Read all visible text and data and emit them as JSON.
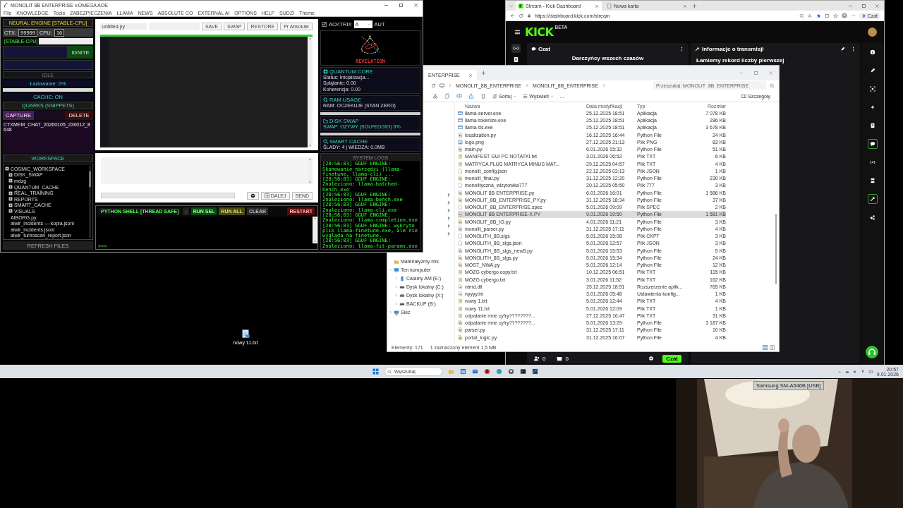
{
  "app_window": {
    "title": "MONOLIT 8B ENTERPRISE v.OMEGA AOE",
    "menu": [
      "File",
      "KNOWLEDGE",
      "Tools",
      "ZABEZPIECZENIA",
      "LLAMA",
      "NEWS",
      "ABSOLUTE CO",
      "EXTERNAL AI",
      "OPTIONS",
      "HELP",
      "SUDZI",
      "Theme"
    ],
    "engine": {
      "header": "NEURAL ENGINE [STABLE-CPU]",
      "ctx_label": "CTX:",
      "ctx_value": "99999",
      "cpu_label": "CPU:",
      "cpu_value": "16",
      "mode_tag": "[STABLE-CPU]",
      "ignite": "IGNITE",
      "status": "IDLE",
      "loading": "Ładowanie: 0%",
      "level": 0,
      "cache": "CACHE: ON"
    },
    "quarks": {
      "header": "QUARKS (SNIPPETS)",
      "capture": "CAPTURE",
      "delete": "DELETE",
      "items": [
        "CTXMEM_CHAT_20260105_230012_8648"
      ]
    },
    "workspace": {
      "header": "WORKSPACE",
      "tree": [
        {
          "label": "COSMIC_WORKSPACE",
          "kind": "folder",
          "children": [
            {
              "label": "DISK_SWAP",
              "kind": "folder"
            },
            {
              "label": "mdzg",
              "kind": "folder"
            },
            {
              "label": "QUANTUM_CACHE",
              "kind": "folder"
            },
            {
              "label": "REAL_TRAINING",
              "kind": "folder"
            },
            {
              "label": "REPORTS",
              "kind": "folder"
            },
            {
              "label": "SMART_CACHE",
              "kind": "folder"
            },
            {
              "label": "VISUALS",
              "kind": "folder"
            },
            {
              "label": "AIBORG.py",
              "kind": "file"
            },
            {
              "label": "aiwir_incidents — kopia.jsonl",
              "kind": "file"
            },
            {
              "label": "aiwir_incidents.jsonl",
              "kind": "file"
            },
            {
              "label": "aiwir_turboscan_report.json",
              "kind": "file"
            }
          ]
        }
      ],
      "refresh": "REFRESH FILES"
    },
    "editor": {
      "filename": "untitled.py",
      "buttons": [
        "SAVE",
        "SWAP",
        "RESTORE",
        "Pr Absolute"
      ],
      "level": 1,
      "next": "DALEJ",
      "send": "SEND"
    },
    "shell": {
      "title": "PYTHON SHELL [THREAD SAFE]",
      "buttons": [
        {
          "label": "-",
          "kind": "plain"
        },
        {
          "label": "RUN SEL",
          "kind": "run"
        },
        {
          "label": "RUN ALL",
          "kind": "all"
        },
        {
          "label": "CLEAR",
          "kind": "clear"
        }
      ],
      "restart": "RESTART",
      "prompt": ">>>"
    },
    "side": {
      "toggle": {
        "label": "ACKTRIX",
        "checked": true
      },
      "select": "A",
      "auto": "AUT",
      "visual_label": "REVELATION",
      "cards": [
        {
          "title": "QUANTUM CORE",
          "kind": "core",
          "lines": [
            "Status: Inicjalizacja...",
            "Splątanie: 0.00",
            "Koherencja: 0.00"
          ]
        },
        {
          "title": "RAM USAGE",
          "kind": "ram",
          "lines": [
            "RAM: OCZEKUJE (STAN ZERO)"
          ],
          "level": 0
        },
        {
          "title": "DISK SWAP",
          "kind": "disk",
          "lines": [
            "SWAP: OŻYWY (SOLFEGGIO) 0%"
          ],
          "level": 0
        },
        {
          "title": "SMART CACHE",
          "kind": "cache",
          "lines": [
            "ŚLADY: 4 | WIEDZA: 0.0MB"
          ]
        }
      ],
      "logs": {
        "title": "SYSTEM LOGS",
        "lines": [
          "[20:56:03] GGUF ENGINE: Skanowanie narzędzi (llama-finetune, llama-cli) ...",
          "[20:56:03] GGUF ENGINE: Znaleziono: llama-batched-bench.exe",
          "[20:56:03] GGUF ENGINE: Znaleziono: llama-bench.exe",
          "[20:56:03] GGUF ENGINE: Znaleziono: llama-cli.exe",
          "[20:56:03] GGUF ENGINE: Znaleziono: llama-completion.exe",
          "[20:56:03] GGUF ENGINE: wykryto plik llama-finetune.exe, ale nie wygląda na finetune.",
          "[20:56:03] GGUF ENGINE: Znaleziono: llama-fit-params.exe"
        ]
      }
    }
  },
  "browser": {
    "tabs": [
      {
        "label": "Stream - Kick Dashboard",
        "selected": true
      },
      {
        "label": "Nowa karta",
        "selected": false
      }
    ],
    "url": "https://dashboard.kick.com/stream",
    "copilot": "Czat",
    "logo": "KICK",
    "logo_badge": "BETA",
    "nav": [
      {
        "kind": "broadcast",
        "selected": true
      },
      {
        "kind": "doc",
        "selected": false
      }
    ],
    "panels": [
      {
        "title": "Czat",
        "kind": "chat",
        "body": "Darczyńcy wszech czasów"
      },
      {
        "title": "Informacje o transmisji",
        "kind": "info",
        "body": "Łamiemy rekord liczby pierwszej"
      }
    ],
    "footer": {
      "viewers": "0",
      "gifts": "0",
      "chat_button": "Czat"
    },
    "rail": [
      {
        "kind": "info",
        "selected": false
      },
      {
        "kind": "pencil",
        "selected": false
      },
      {
        "kind": "scan",
        "selected": false
      },
      {
        "kind": "bolt",
        "selected": false
      },
      {
        "kind": "doc",
        "selected": false
      },
      {
        "kind": "chat",
        "selected": true
      },
      {
        "kind": "broadcast",
        "selected": false
      },
      {
        "kind": "stack",
        "selected": false
      },
      {
        "kind": "wrench",
        "selected": true
      },
      {
        "kind": "share",
        "selected": false
      }
    ]
  },
  "explorer": {
    "tab": "ENTERPRISE",
    "breadcrumb": [
      "MONOLIT_8B_ENTERPRISE",
      "MONOLIT_8B_ENTERPRISE"
    ],
    "search_placeholder": "Przeszukaj: MONOLIT_8B_ENTERPRISE",
    "toolbar": [
      "Sortuj",
      "Wyświetl",
      "..."
    ],
    "details": "Szczegóły",
    "nav": [
      {
        "label": "Materiałyzmy mis",
        "kind": "folder"
      },
      {
        "label": "Ten komputer",
        "kind": "computer",
        "expanded": true,
        "children": [
          {
            "label": "Calamy AM (E:)",
            "kind": "drive",
            "expanded": false
          },
          {
            "label": "Dysk lokalny (C:)",
            "kind": "disk",
            "expanded": false
          },
          {
            "label": "Dysk lokalny (X:)",
            "kind": "disk",
            "expanded": false
          },
          {
            "label": "BACKUP (B:)",
            "kind": "disk",
            "expanded": false
          }
        ]
      },
      {
        "label": "Sieć",
        "kind": "network",
        "expanded": false
      }
    ],
    "columns": [
      "Nazwa",
      "Data modyfikacji",
      "Typ",
      "Rozmiar"
    ],
    "files": [
      {
        "name": "llama-server.exe",
        "modified": "25.12.2025 18:51",
        "type": "Aplikacja",
        "size": "7 078 KB",
        "kind": "exe",
        "selected": false
      },
      {
        "name": "llama-tokenize.exe",
        "modified": "25.12.2025 18:51",
        "type": "Aplikacja",
        "size": "286 KB",
        "kind": "exe",
        "selected": false
      },
      {
        "name": "llama-tts.exe",
        "modified": "25.12.2025 18:51",
        "type": "Aplikacja",
        "size": "3 678 KB",
        "kind": "exe",
        "selected": false
      },
      {
        "name": "localization.py",
        "modified": "16.12.2025 16:44",
        "type": "Python File",
        "size": "24 KB",
        "kind": "py",
        "selected": false
      },
      {
        "name": "logo.png",
        "modified": "27.12.2025 21:13",
        "type": "Plik PNG",
        "size": "83 KB",
        "kind": "png",
        "selected": false
      },
      {
        "name": "main.py",
        "modified": "6.01.2026 15:32",
        "type": "Python File",
        "size": "51 KB",
        "kind": "py",
        "selected": false
      },
      {
        "name": "MANIFEST GUI PC NOTATKI.txt",
        "modified": "3.01.2026 06:52",
        "type": "Plik TXT",
        "size": "6 KB",
        "kind": "txt",
        "selected": false
      },
      {
        "name": "MATRYCA PLUS MATRYCA MINUS MAT...",
        "modified": "29.12.2025 04:57",
        "type": "Plik TXT",
        "size": "4 KB",
        "kind": "txt",
        "selected": false
      },
      {
        "name": "monolit_config.json",
        "modified": "22.12.2025 03:13",
        "type": "Plik JSON",
        "size": "1 KB",
        "kind": "plain",
        "selected": false
      },
      {
        "name": "monolit_final.py",
        "modified": "31.12.2025 12:20",
        "type": "Python File",
        "size": "230 KB",
        "kind": "py",
        "selected": false
      },
      {
        "name": "monolityczna_wizytowka777",
        "modified": "20.12.2025 05:50",
        "type": "Plik 777",
        "size": "3 KB",
        "kind": "plain",
        "selected": false
      },
      {
        "name": "MONOLIT 8B ENTERPRISE.py",
        "modified": "6.01.2026 16:01",
        "type": "Python File",
        "size": "1 586 KB",
        "kind": "py",
        "selected": false
      },
      {
        "name": "MONOLIT_8B_ENTERPRISE_PY.py",
        "modified": "31.12.2025 18:34",
        "type": "Python File",
        "size": "37 KB",
        "kind": "py",
        "selected": false
      },
      {
        "name": "MONOLIT_8B_ENTERPRISE.spec",
        "modified": "5.01.2026 09:09",
        "type": "Plik SPEC",
        "size": "2 KB",
        "kind": "plain",
        "selected": false
      },
      {
        "name": "MONOLIT 8B ENTERPRISE-X.PY",
        "modified": "9.01.2026 19:50",
        "type": "Python File",
        "size": "1 581 KB",
        "kind": "py",
        "selected": true
      },
      {
        "name": "MONOLIT_8B_IO.py",
        "modified": "4.01.2026 11:21",
        "type": "Python File",
        "size": "3 KB",
        "kind": "py",
        "selected": false
      },
      {
        "name": "monolit_parser.py",
        "modified": "31.12.2025 17:11",
        "type": "Python File",
        "size": "4 KB",
        "kind": "py",
        "selected": false
      },
      {
        "name": "MONOLITH_8B.slgs",
        "modified": "5.01.2026 15:08",
        "type": "Plik CKPT",
        "size": "3 KB",
        "kind": "plain",
        "selected": false
      },
      {
        "name": "MONOLITH_8B_slgs.json",
        "modified": "5.01.2026 12:57",
        "type": "Plik JSON",
        "size": "3 KB",
        "kind": "plain",
        "selected": false
      },
      {
        "name": "MONOLITH_8B_slgs_new5.py",
        "modified": "5.01.2026 15:53",
        "type": "Python File",
        "size": "5 KB",
        "kind": "py",
        "selected": false
      },
      {
        "name": "MONOLITH_8B_slgs.py",
        "modified": "5.01.2026 15:34",
        "type": "Python File",
        "size": "24 KB",
        "kind": "py",
        "selected": false
      },
      {
        "name": "MOST_NWA.py",
        "modified": "5.01.2026 12:14",
        "type": "Python File",
        "size": "12 KB",
        "kind": "py",
        "selected": false
      },
      {
        "name": "MÓZG cybergo copy.txt",
        "modified": "10.12.2025 06:51",
        "type": "Plik TXT",
        "size": "115 KB",
        "kind": "txt",
        "selected": false
      },
      {
        "name": "MÓZG cybergo.txt",
        "modified": "3.01.2026 11:52",
        "type": "Plik TXT",
        "size": "162 KB",
        "kind": "txt",
        "selected": false
      },
      {
        "name": "ntmd.dll",
        "modified": "25.12.2025 18:51",
        "type": "Rozszerzenie aplik...",
        "size": "765 KB",
        "kind": "gear",
        "selected": false
      },
      {
        "name": "nyyyy.ini",
        "modified": "3.01.2026 05:48",
        "type": "Ustawienia konfig...",
        "size": "1 KB",
        "kind": "gear",
        "selected": false
      },
      {
        "name": "nowy 1.txt",
        "modified": "5.01.2026 12:44",
        "type": "Plik TXT",
        "size": "4 KB",
        "kind": "txt",
        "selected": false
      },
      {
        "name": "nowy 11.txt",
        "modified": "5.01.2026 12:09",
        "type": "Plik TXT",
        "size": "1 KB",
        "kind": "txt",
        "selected": false
      },
      {
        "name": "odpalanie mne cyfry????????...",
        "modified": "27.12.2025 16:47",
        "type": "Plik TXT",
        "size": "31 KB",
        "kind": "txt",
        "selected": false
      },
      {
        "name": "odpalanie mne cyfry????????...",
        "modified": "5.01.2026 13:29",
        "type": "Python File",
        "size": "3 187 KB",
        "kind": "py",
        "selected": false
      },
      {
        "name": "parser.py",
        "modified": "31.12.2025 17:11",
        "type": "Python File",
        "size": "10 KB",
        "kind": "py",
        "selected": false
      },
      {
        "name": "portal_logic.py",
        "modified": "31.12.2025 16:07",
        "type": "Python File",
        "size": "4 KB",
        "kind": "py",
        "selected": false
      }
    ],
    "status": [
      "Elementy: 171",
      "1 zaznaczony element  1,5 MB"
    ]
  },
  "desktop": {
    "icon_label": "nowy 11.txt"
  },
  "taskbar": {
    "search_placeholder": "Wyszukaj",
    "time": "20:57",
    "date": "9.01.2026"
  },
  "webcam": {
    "label": "Samsung SM-A546B [USB]"
  }
}
